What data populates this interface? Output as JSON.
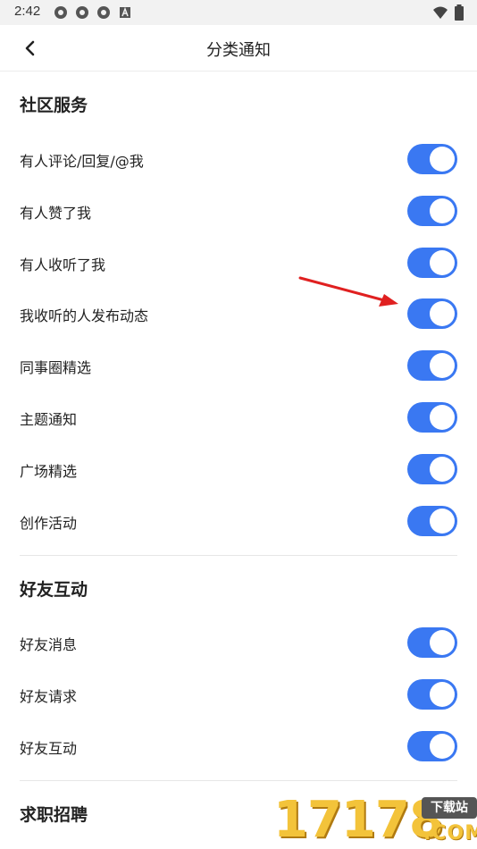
{
  "status_bar": {
    "time": "2:42"
  },
  "header": {
    "title": "分类通知"
  },
  "sections": [
    {
      "title": "社区服务",
      "items": [
        {
          "label": "有人评论/回复/@我",
          "enabled": true
        },
        {
          "label": "有人赞了我",
          "enabled": true
        },
        {
          "label": "有人收听了我",
          "enabled": true
        },
        {
          "label": "我收听的人发布动态",
          "enabled": true
        },
        {
          "label": "同事圈精选",
          "enabled": true
        },
        {
          "label": "主题通知",
          "enabled": true
        },
        {
          "label": "广场精选",
          "enabled": true
        },
        {
          "label": "创作活动",
          "enabled": true
        }
      ]
    },
    {
      "title": "好友互动",
      "items": [
        {
          "label": "好友消息",
          "enabled": true
        },
        {
          "label": "好友请求",
          "enabled": true
        },
        {
          "label": "好友互动",
          "enabled": true
        }
      ]
    },
    {
      "title": "求职招聘",
      "items": []
    }
  ],
  "watermark": {
    "number": "17178",
    "badge": "下载站",
    "domain": ".COM"
  },
  "colors": {
    "toggle_on": "#3a78f2",
    "arrow": "#e02020"
  }
}
